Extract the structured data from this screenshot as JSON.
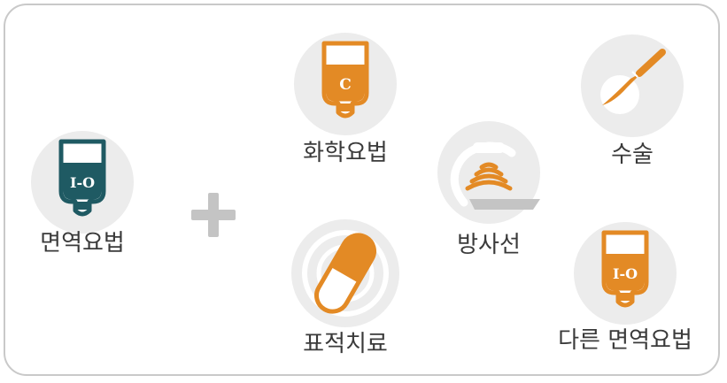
{
  "colors": {
    "teal": "#1f5a63",
    "orange": "#e38a25",
    "gray_circle": "#ececec",
    "gray_mark": "#c4c4c4",
    "text": "#3a3a3a"
  },
  "items": {
    "immunotherapy": {
      "label": "면역요법",
      "bag_text": "I-O",
      "icon": "iv-bag-icon"
    },
    "chemotherapy": {
      "label": "화학요법",
      "bag_text": "C",
      "icon": "iv-bag-icon"
    },
    "targeted_therapy": {
      "label": "표적치료",
      "icon": "capsule-icon"
    },
    "radiation": {
      "label": "방사선",
      "icon": "radiation-machine-icon"
    },
    "surgery": {
      "label": "수술",
      "icon": "scalpel-icon"
    },
    "other_immunotherapy": {
      "label": "다른 면역요법",
      "bag_text": "I-O",
      "icon": "iv-bag-icon"
    }
  },
  "connector": {
    "icon": "plus-icon"
  }
}
